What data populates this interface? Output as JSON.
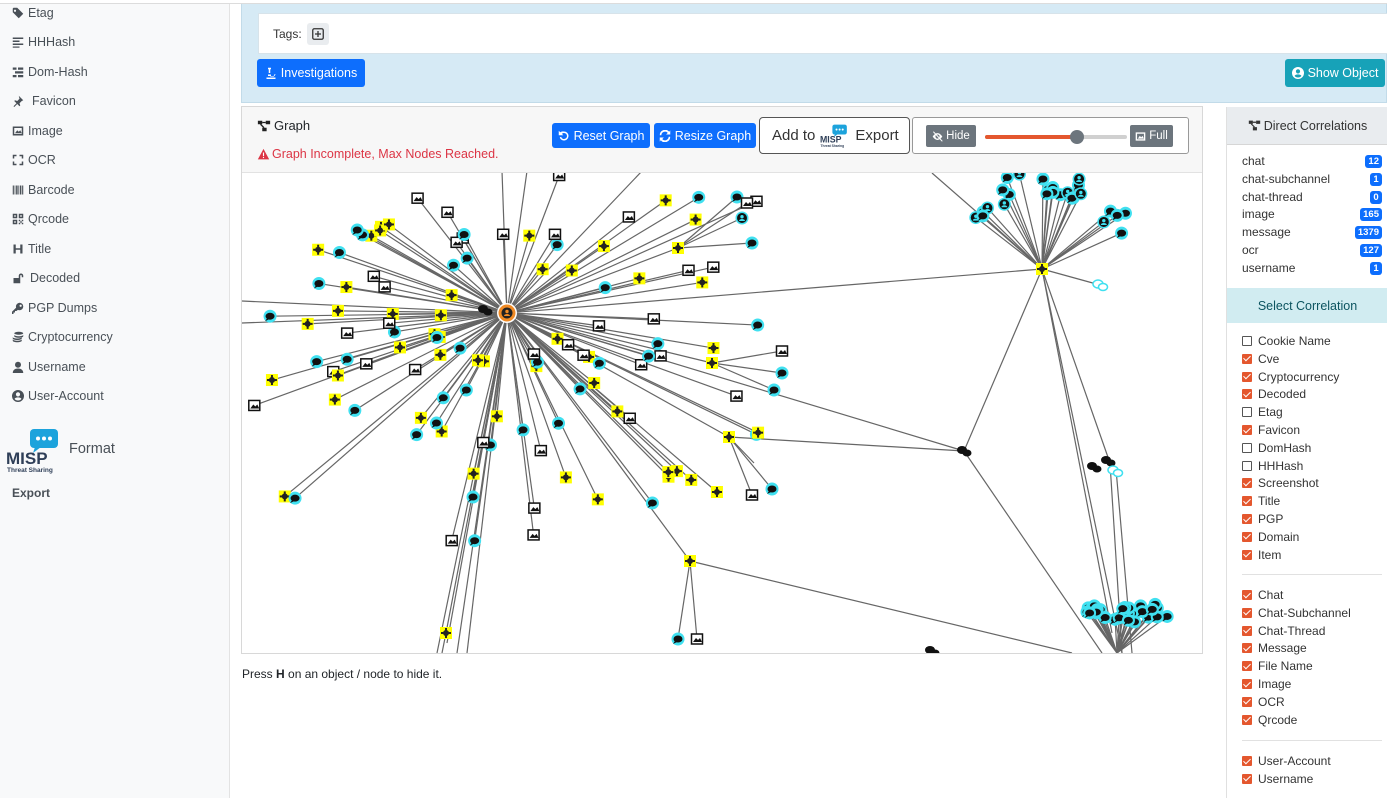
{
  "sidebar": {
    "items": [
      {
        "label": "Etag",
        "icon": "tag-icon"
      },
      {
        "label": "HHHash",
        "icon": "align-left-icon"
      },
      {
        "label": "Dom-Hash",
        "icon": "sitemap-icon"
      },
      {
        "label": "Favicon",
        "icon": "thumbtack-icon"
      },
      {
        "label": "Image",
        "icon": "image-icon"
      },
      {
        "label": "OCR",
        "icon": "expand-icon"
      },
      {
        "label": "Barcode",
        "icon": "barcode-icon"
      },
      {
        "label": "Qrcode",
        "icon": "qrcode-icon"
      },
      {
        "label": "Title",
        "icon": "heading-icon"
      },
      {
        "label": "Decoded",
        "icon": "lock-open-icon"
      },
      {
        "label": "PGP Dumps",
        "icon": "key-icon"
      },
      {
        "label": "Cryptocurrency",
        "icon": "coins-icon"
      },
      {
        "label": "Username",
        "icon": "user-icon"
      },
      {
        "label": "User-Account",
        "icon": "user-circle-icon"
      }
    ],
    "misp_logo_text": "MISP",
    "misp_logo_sub": "Threat Sharing",
    "misp_format_label": "Format",
    "export_label": "Export"
  },
  "top": {
    "tags_label": "Tags:",
    "investigations_label": "Investigations",
    "show_object_label": "Show Object"
  },
  "graph": {
    "title": "Graph",
    "warning": "Graph Incomplete, Max Nodes Reached.",
    "reset_label": "Reset Graph",
    "resize_label": "Resize Graph",
    "add_to_label": "Add to",
    "export_label": "Export",
    "hide_label": "Hide",
    "full_label": "Full",
    "slider_value": 0.65,
    "hint_prefix": "Press ",
    "hint_key": "H",
    "hint_suffix": " on an object / node to hide it.",
    "colors": {
      "accent": "#e4572e",
      "node_yellow": "#ffff00",
      "node_cyan": "#40e0f0",
      "edge": "#666666"
    }
  },
  "correlations": {
    "title": "Direct Correlations",
    "items": [
      {
        "name": "chat",
        "count": "12"
      },
      {
        "name": "chat-subchannel",
        "count": "1"
      },
      {
        "name": "chat-thread",
        "count": "0"
      },
      {
        "name": "image",
        "count": "165"
      },
      {
        "name": "message",
        "count": "1379"
      },
      {
        "name": "ocr",
        "count": "127"
      },
      {
        "name": "username",
        "count": "1"
      }
    ]
  },
  "select_correlation": {
    "title": "Select Correlation",
    "group1": [
      {
        "label": "Cookie Name",
        "checked": false
      },
      {
        "label": "Cve",
        "checked": true
      },
      {
        "label": "Cryptocurrency",
        "checked": true
      },
      {
        "label": "Decoded",
        "checked": true
      },
      {
        "label": "Etag",
        "checked": false
      },
      {
        "label": "Favicon",
        "checked": true
      },
      {
        "label": "DomHash",
        "checked": false
      },
      {
        "label": "HHHash",
        "checked": false
      },
      {
        "label": "Screenshot",
        "checked": true
      },
      {
        "label": "Title",
        "checked": true
      },
      {
        "label": "PGP",
        "checked": true
      },
      {
        "label": "Domain",
        "checked": true
      },
      {
        "label": "Item",
        "checked": true
      }
    ],
    "group2": [
      {
        "label": "Chat",
        "checked": true
      },
      {
        "label": "Chat-Subchannel",
        "checked": true
      },
      {
        "label": "Chat-Thread",
        "checked": true
      },
      {
        "label": "Message",
        "checked": true
      },
      {
        "label": "File Name",
        "checked": true
      },
      {
        "label": "Image",
        "checked": true
      },
      {
        "label": "OCR",
        "checked": true
      },
      {
        "label": "Qrcode",
        "checked": true
      }
    ],
    "group3": [
      {
        "label": "User-Account",
        "checked": true
      },
      {
        "label": "Username",
        "checked": true
      }
    ]
  }
}
